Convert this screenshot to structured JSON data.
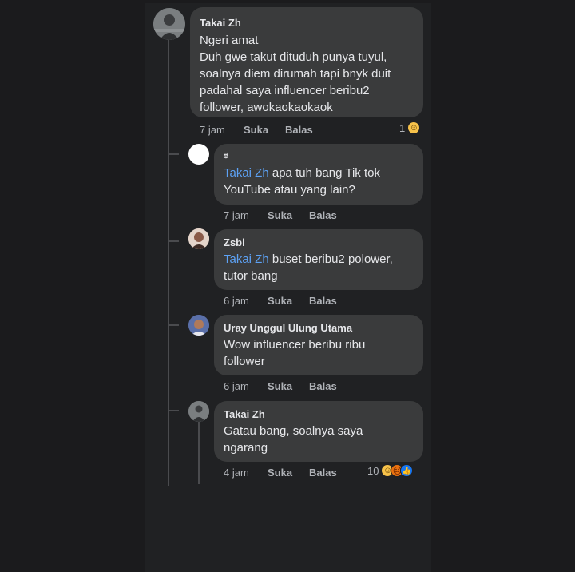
{
  "comments": [
    {
      "name": "Takai Zh",
      "lines": [
        "Ngeri amat",
        "Duh gwe takut dituduh punya tuyul,",
        "soalnya diem dirumah tapi bnyk duit",
        "padahal saya influencer beribu2",
        "follower, awokaokaokaok"
      ],
      "time": "7 jam",
      "like": "Suka",
      "reply": "Balas",
      "reaction_count": "1",
      "reactions": [
        "haha-icon"
      ]
    },
    {
      "name": "ಠ",
      "mention": "Takai Zh",
      "lines": [
        " apa tuh bang Tik tok",
        "YouTube atau yang lain?"
      ],
      "time": "7 jam",
      "like": "Suka",
      "reply": "Balas"
    },
    {
      "name": "Zsbl",
      "mention": "Takai Zh",
      "lines": [
        " buset beribu2 polower,",
        "tutor bang"
      ],
      "time": "6 jam",
      "like": "Suka",
      "reply": "Balas"
    },
    {
      "name": "Uray Unggul Ulung Utama",
      "lines": [
        "Wow influencer beribu ribu",
        "follower"
      ],
      "time": "6 jam",
      "like": "Suka",
      "reply": "Balas"
    },
    {
      "name": "Takai Zh",
      "lines": [
        "Gatau bang, soalnya saya",
        "ngarang"
      ],
      "time": "4 jam",
      "like": "Suka",
      "reply": "Balas",
      "reaction_count": "10",
      "reactions": [
        "haha-icon",
        "angry-icon",
        "like-icon"
      ]
    }
  ],
  "colors": {
    "mention": "#5da2f5",
    "bubble": "#3a3b3c",
    "panel": "#202123",
    "text": "#e6e7ea",
    "meta": "#b0b3b8"
  }
}
